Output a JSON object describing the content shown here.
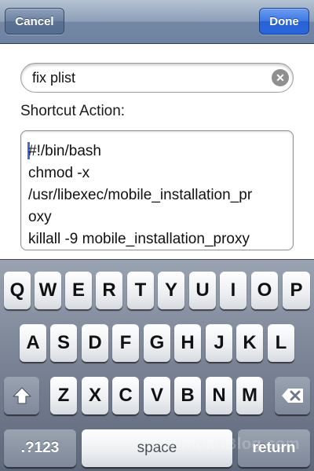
{
  "navbar": {
    "cancel_label": "Cancel",
    "done_label": "Done"
  },
  "form": {
    "name_value": "fix plist",
    "clear_glyph": "✕",
    "action_label": "Shortcut Action:",
    "script_lines": [
      "#!/bin/bash",
      "chmod -x",
      "/usr/libexec/mobile_installation_pr",
      "oxy",
      "killall -9 mobile_installation_proxy",
      "..."
    ]
  },
  "keyboard": {
    "row1": [
      "Q",
      "W",
      "E",
      "R",
      "T",
      "Y",
      "U",
      "I",
      "O",
      "P"
    ],
    "row2": [
      "A",
      "S",
      "D",
      "F",
      "G",
      "H",
      "J",
      "K",
      "L"
    ],
    "row3": [
      "Z",
      "X",
      "C",
      "V",
      "B",
      "N",
      "M"
    ],
    "shift_icon": "shift-icon",
    "backspace_icon": "backspace-icon",
    "numbers_label": ".?123",
    "space_label": "space",
    "return_label": "return"
  },
  "watermark": "iDownloadBlog.com",
  "colors": {
    "done_button": "#2a66da",
    "navbar": "#7d90ad",
    "caret": "#3f6ad8"
  }
}
